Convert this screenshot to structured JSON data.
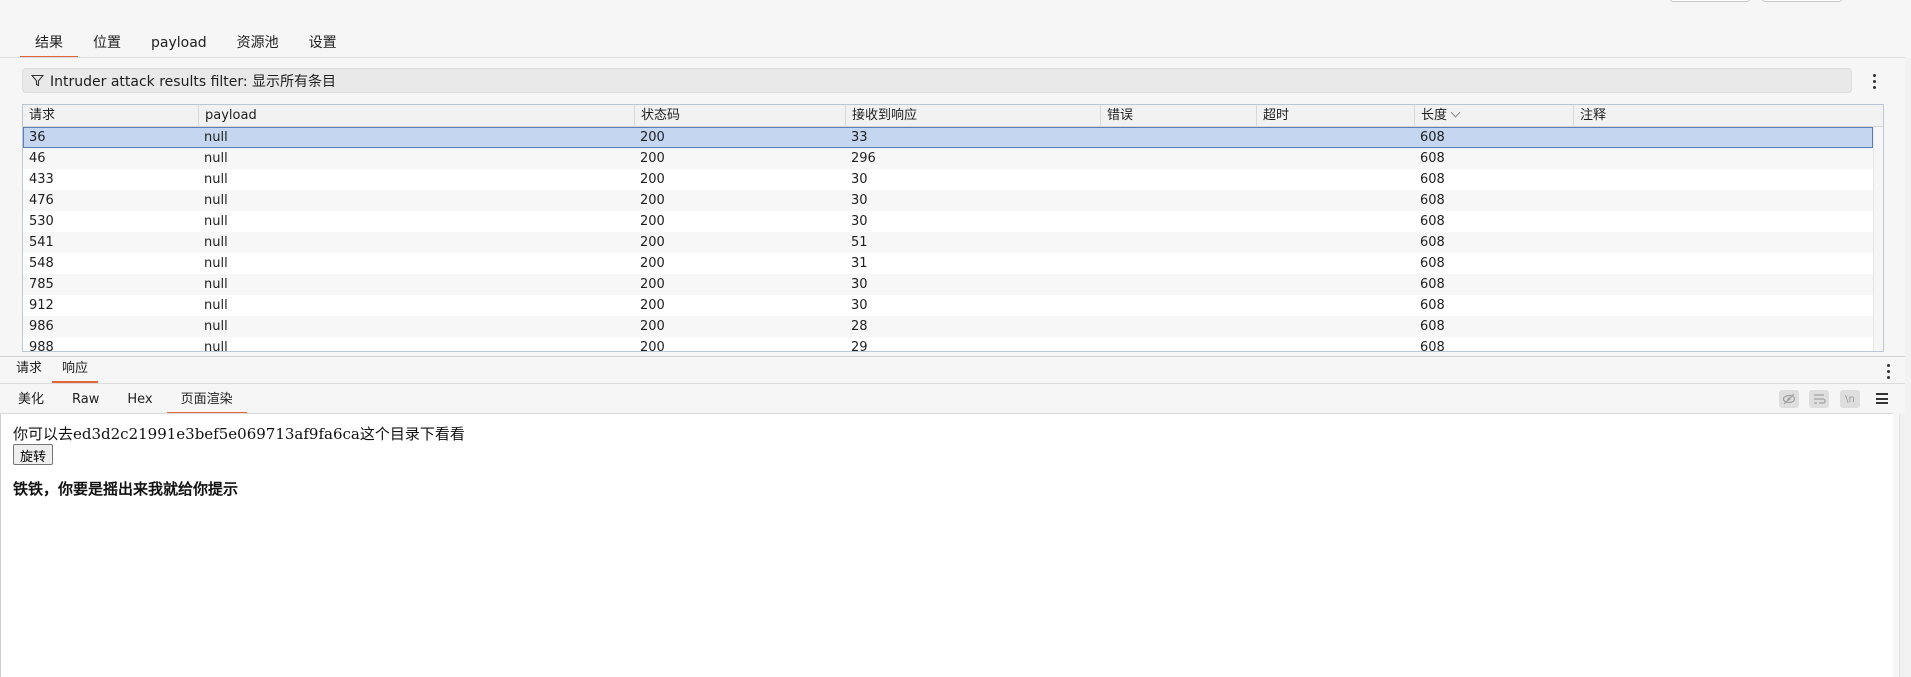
{
  "main_tabs": [
    "结果",
    "位置",
    "payload",
    "资源池",
    "设置"
  ],
  "filter": {
    "label": "Intruder attack results filter: 显示所有条目"
  },
  "table": {
    "columns": [
      "请求",
      "payload",
      "状态码",
      "接收到响应",
      "错误",
      "超时",
      "长度",
      "注释"
    ],
    "rows": [
      [
        "36",
        "null",
        "200",
        "33",
        "",
        "",
        "608",
        ""
      ],
      [
        "46",
        "null",
        "200",
        "296",
        "",
        "",
        "608",
        ""
      ],
      [
        "433",
        "null",
        "200",
        "30",
        "",
        "",
        "608",
        ""
      ],
      [
        "476",
        "null",
        "200",
        "30",
        "",
        "",
        "608",
        ""
      ],
      [
        "530",
        "null",
        "200",
        "30",
        "",
        "",
        "608",
        ""
      ],
      [
        "541",
        "null",
        "200",
        "51",
        "",
        "",
        "608",
        ""
      ],
      [
        "548",
        "null",
        "200",
        "31",
        "",
        "",
        "608",
        ""
      ],
      [
        "785",
        "null",
        "200",
        "30",
        "",
        "",
        "608",
        ""
      ],
      [
        "912",
        "null",
        "200",
        "30",
        "",
        "",
        "608",
        ""
      ],
      [
        "986",
        "null",
        "200",
        "28",
        "",
        "",
        "608",
        ""
      ],
      [
        "988",
        "null",
        "200",
        "29",
        "",
        "",
        "608",
        ""
      ]
    ],
    "selected_row": 0
  },
  "detail_tabs": [
    "请求",
    "响应"
  ],
  "view_tabs": [
    "美化",
    "Raw",
    "Hex",
    "页面渲染"
  ],
  "toolbar_icons": {
    "hide": "eye-slash-icon",
    "wrap": "word-wrap-icon",
    "newline": "newline-icon",
    "menu": "hamburger-menu-icon",
    "newline_glyph": "\\n"
  },
  "render": {
    "text": "你可以去ed3d2c21991e3bef5e069713af9fa6ca这个目录下看看",
    "button": "旋转",
    "hint": "铁铁，你要是摇出来我就给你提示"
  },
  "colors": {
    "accent": "#e2663a",
    "selected_row": "#c5d7f0"
  }
}
